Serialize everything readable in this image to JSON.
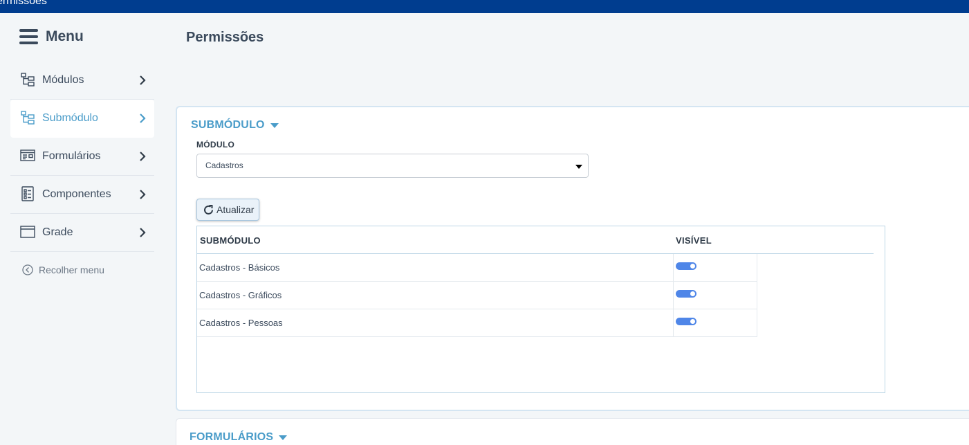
{
  "topbar": {
    "title": "ermissoes"
  },
  "sidebar": {
    "menu_title": "Menu",
    "items": [
      {
        "label": "Módulos",
        "icon": "hierarchy-icon",
        "active": false
      },
      {
        "label": "Submódulo",
        "icon": "hierarchy-icon",
        "active": true
      },
      {
        "label": "Formulários",
        "icon": "form-icon",
        "active": false
      },
      {
        "label": "Componentes",
        "icon": "checklist-icon",
        "active": false
      },
      {
        "label": "Grade",
        "icon": "window-icon",
        "active": false
      }
    ],
    "collapse_label": "Recolher menu"
  },
  "page": {
    "title": "Permissões"
  },
  "submodulo_card": {
    "heading": "SUBMÓDULO",
    "field_label": "MÓDULO",
    "select_value": "Cadastros",
    "refresh_label": "Atualizar",
    "table": {
      "headers": [
        "SUBMÓDULO",
        "VISÍVEL"
      ],
      "rows": [
        {
          "name": "Cadastros - Básicos",
          "visible": true
        },
        {
          "name": "Cadastros - Gráficos",
          "visible": true
        },
        {
          "name": "Cadastros - Pessoas",
          "visible": true
        }
      ]
    }
  },
  "formularios_card": {
    "heading": "FORMULÁRIOS"
  },
  "colors": {
    "topbar": "#003d8f",
    "accent": "#4a9cc9",
    "toggle_on": "#4f86e8"
  }
}
